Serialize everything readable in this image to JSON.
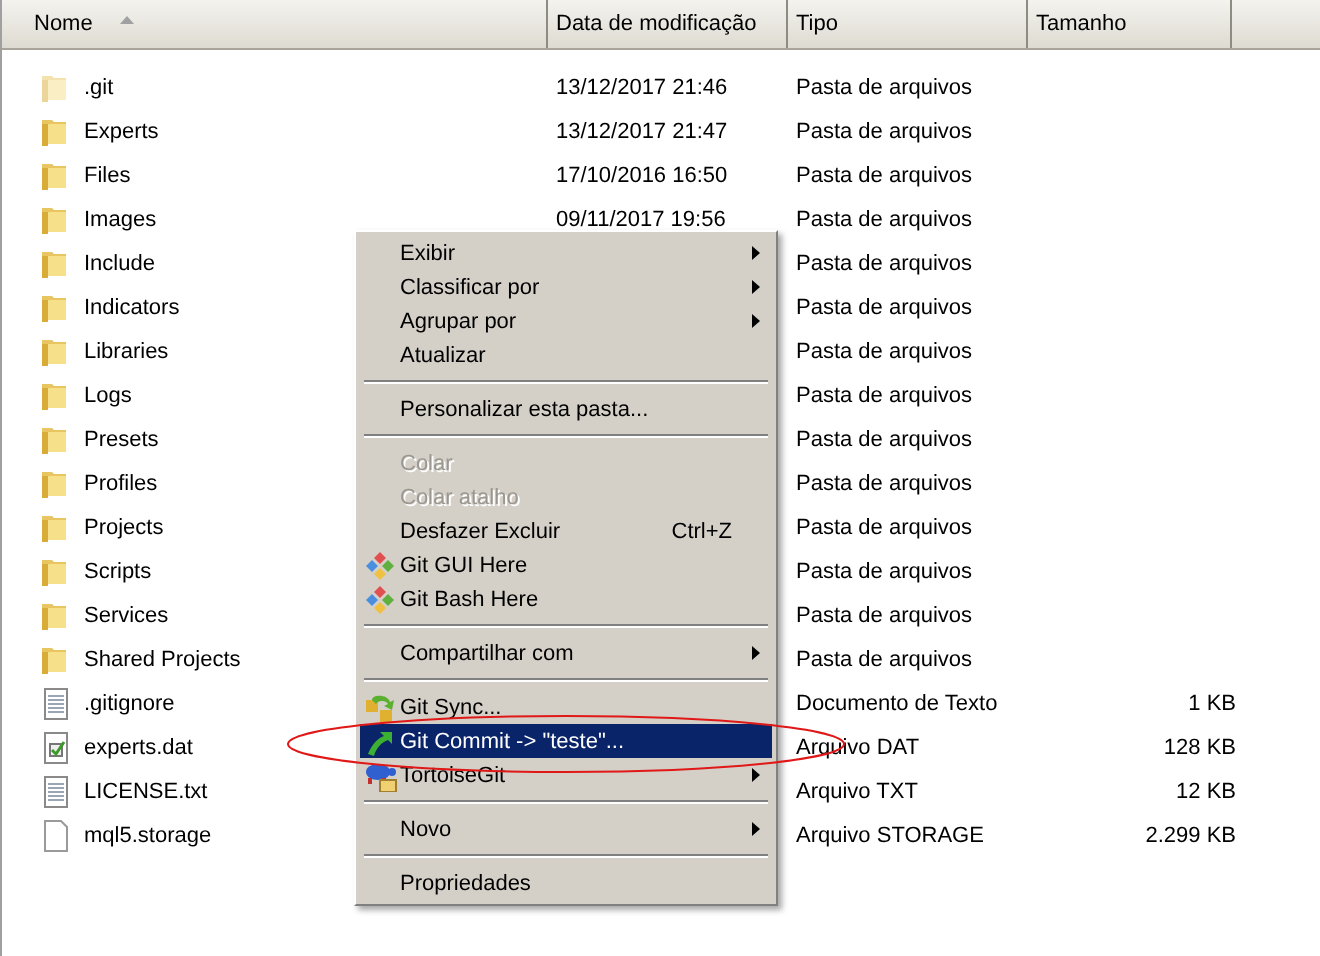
{
  "columns": [
    {
      "label": "Nome",
      "sorted": true
    },
    {
      "label": "Data de modificação",
      "sorted": false
    },
    {
      "label": "Tipo",
      "sorted": false
    },
    {
      "label": "Tamanho",
      "sorted": false
    }
  ],
  "files": [
    {
      "name": ".git",
      "kind": "folder",
      "hidden": true,
      "date": "13/12/2017 21:46",
      "type": "Pasta de arquivos"
    },
    {
      "name": "Experts",
      "kind": "folder",
      "hidden": false,
      "date": "13/12/2017 21:47",
      "type": "Pasta de arquivos"
    },
    {
      "name": "Files",
      "kind": "folder",
      "hidden": false,
      "date": "17/10/2016 16:50",
      "type": "Pasta de arquivos"
    },
    {
      "name": "Images",
      "kind": "folder",
      "hidden": false,
      "date": "09/11/2017 19:56",
      "type": "Pasta de arquivos"
    },
    {
      "name": "Include",
      "kind": "folder",
      "hidden": false,
      "type": "Pasta de arquivos"
    },
    {
      "name": "Indicators",
      "kind": "folder",
      "hidden": false,
      "type": "Pasta de arquivos"
    },
    {
      "name": "Libraries",
      "kind": "folder",
      "hidden": false,
      "type": "Pasta de arquivos"
    },
    {
      "name": "Logs",
      "kind": "folder",
      "hidden": false,
      "type": "Pasta de arquivos"
    },
    {
      "name": "Presets",
      "kind": "folder",
      "hidden": false,
      "type": "Pasta de arquivos"
    },
    {
      "name": "Profiles",
      "kind": "folder",
      "hidden": false,
      "type": "Pasta de arquivos"
    },
    {
      "name": "Projects",
      "kind": "folder",
      "hidden": false,
      "type": "Pasta de arquivos"
    },
    {
      "name": "Scripts",
      "kind": "folder",
      "hidden": false,
      "type": "Pasta de arquivos"
    },
    {
      "name": "Services",
      "kind": "folder",
      "hidden": false,
      "type": "Pasta de arquivos"
    },
    {
      "name": "Shared Projects",
      "kind": "folder",
      "hidden": false,
      "type": "Pasta de arquivos"
    },
    {
      "name": ".gitignore",
      "kind": "text",
      "hidden": false,
      "type": "Documento de Texto",
      "size": "1 KB"
    },
    {
      "name": "experts.dat",
      "kind": "dat",
      "hidden": false,
      "type": "Arquivo DAT",
      "size": "128 KB"
    },
    {
      "name": "LICENSE.txt",
      "kind": "text",
      "hidden": false,
      "type": "Arquivo TXT",
      "size": "12 KB"
    },
    {
      "name": "mql5.storage",
      "kind": "blank",
      "hidden": false,
      "type": "Arquivo STORAGE",
      "size": "2.299 KB"
    }
  ],
  "context_menu": [
    {
      "kind": "item",
      "label": "Exibir",
      "submenu": true,
      "disabled": false,
      "selected": false
    },
    {
      "kind": "item",
      "label": "Classificar por",
      "submenu": true,
      "disabled": false,
      "selected": false
    },
    {
      "kind": "item",
      "label": "Agrupar por",
      "submenu": true,
      "disabled": false,
      "selected": false
    },
    {
      "kind": "item",
      "label": "Atualizar",
      "submenu": false,
      "disabled": false,
      "selected": false
    },
    {
      "kind": "separator"
    },
    {
      "kind": "item",
      "label": "Personalizar esta pasta...",
      "submenu": false,
      "disabled": false,
      "selected": false
    },
    {
      "kind": "separator"
    },
    {
      "kind": "item",
      "label": "Colar",
      "submenu": false,
      "disabled": true,
      "selected": false
    },
    {
      "kind": "item",
      "label": "Colar atalho",
      "submenu": false,
      "disabled": true,
      "selected": false
    },
    {
      "kind": "item",
      "label": "Desfazer Excluir",
      "shortcut": "Ctrl+Z",
      "submenu": false,
      "disabled": false,
      "selected": false
    },
    {
      "kind": "gui",
      "label": "Git GUI Here",
      "submenu": false,
      "disabled": false,
      "selected": false
    },
    {
      "kind": "bash",
      "label": "Git Bash Here",
      "submenu": false,
      "disabled": false,
      "selected": false
    },
    {
      "kind": "separator"
    },
    {
      "kind": "item",
      "label": "Compartilhar com",
      "submenu": true,
      "disabled": false,
      "selected": false
    },
    {
      "kind": "separator"
    },
    {
      "kind": "sync",
      "label": "Git Sync...",
      "submenu": false,
      "disabled": false,
      "selected": false
    },
    {
      "kind": "commit",
      "label": "Git Commit -> \"teste\"...",
      "submenu": false,
      "disabled": false,
      "selected": true
    },
    {
      "kind": "tortoise",
      "label": "TortoiseGit",
      "submenu": true,
      "disabled": false,
      "selected": false
    },
    {
      "kind": "separator"
    },
    {
      "kind": "item",
      "label": "Novo",
      "submenu": true,
      "disabled": false,
      "selected": false
    },
    {
      "kind": "separator"
    },
    {
      "kind": "item",
      "label": "Propriedades",
      "submenu": false,
      "disabled": false,
      "selected": false
    }
  ]
}
